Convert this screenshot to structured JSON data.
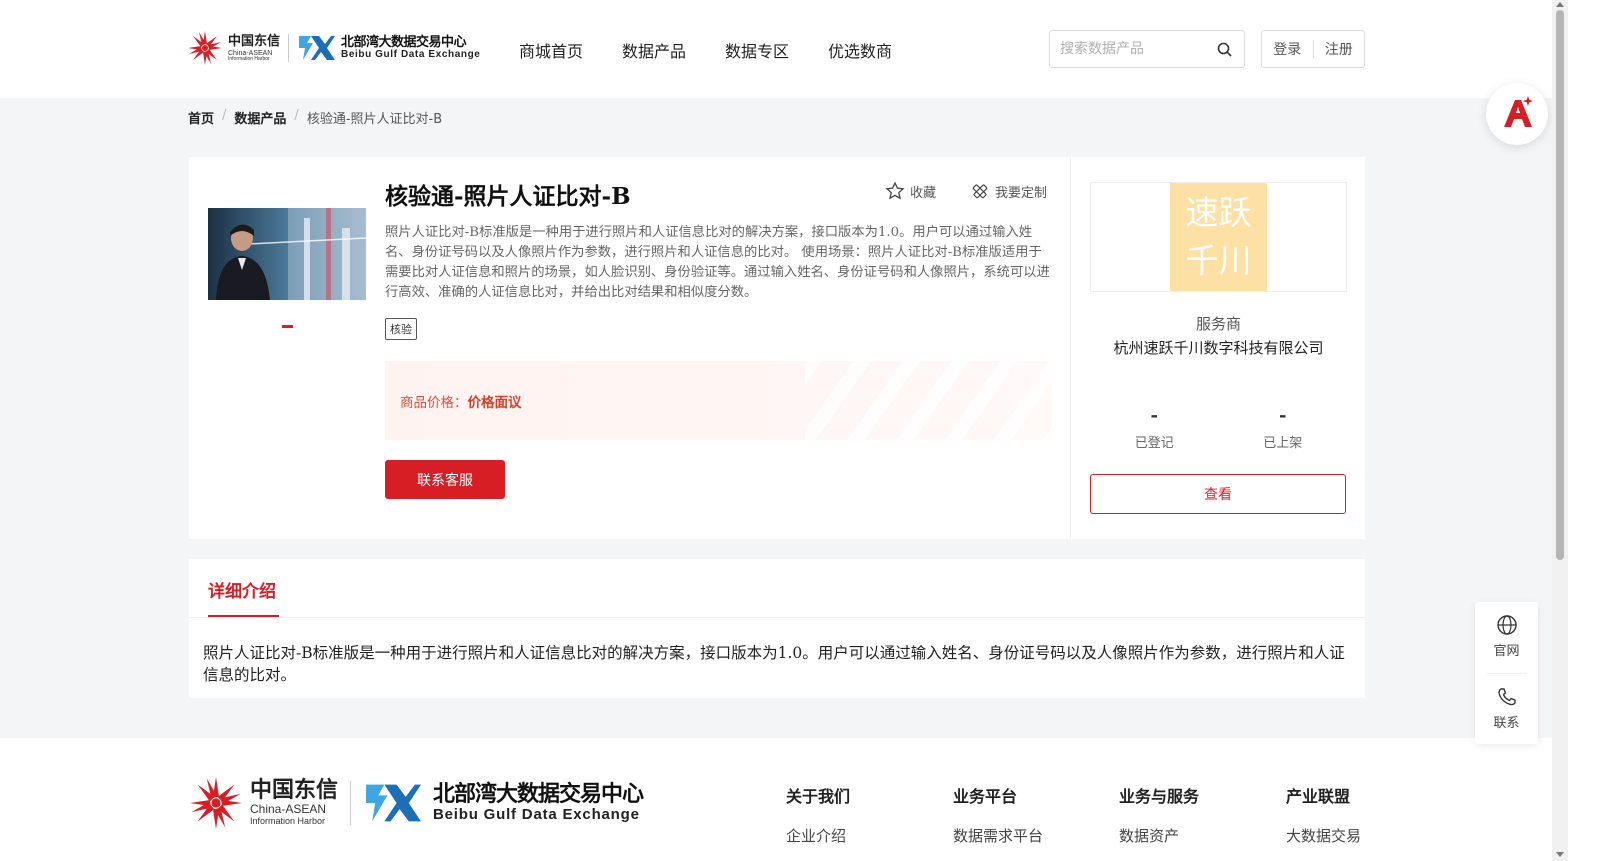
{
  "header": {
    "logo": {
      "partner_cn": "中国东信",
      "partner_en1": "China-ASEAN",
      "partner_en2": "Information Harbor",
      "brand_cn": "北部湾大数据交易中心",
      "brand_en": "Beibu Gulf Data Exchange"
    },
    "nav": [
      "商城首页",
      "数据产品",
      "数据专区",
      "优选数商"
    ],
    "search_placeholder": "搜索数据产品",
    "login": "登录",
    "register": "注册"
  },
  "breadcrumb": {
    "home": "首页",
    "category": "数据产品",
    "current": "核验通-照片人证比对-B",
    "separator": "/"
  },
  "product": {
    "title": "核验通-照片人证比对-B",
    "favorite": "收藏",
    "customize": "我要定制",
    "description": "照片人证比对-B标准版是一种用于进行照片和人证信息比对的解决方案，接口版本为1.0。用户可以通过输入姓名、身份证号码以及人像照片作为参数，进行照片和人证信息的比对。 使用场景：照片人证比对-B标准版适用于需要比对人证信息和照片的场景，如人脸识别、身份验证等。通过输入姓名、身份证号码和人像照片，系统可以进行高效、准确的人证信息比对，并给出比对结果和相似度分数。",
    "tag": "核验",
    "price_label": "商品价格：",
    "price_value": "价格面议",
    "contact_button": "联系客服"
  },
  "vendor": {
    "logo_line1": "速跃",
    "logo_line2": "千川",
    "role": "服务商",
    "name": "杭州速跃千川数字科技有限公司",
    "registered_value": "-",
    "registered_label": "已登记",
    "listed_value": "-",
    "listed_label": "已上架",
    "view_button": "查看"
  },
  "detail": {
    "tab": "详细介绍",
    "body": "照片人证比对-B标准版是一种用于进行照片和人证信息比对的解决方案，接口版本为1.0。用户可以通过输入姓名、身份证号码以及人像照片作为参数，进行照片和人证信息的比对。"
  },
  "footer": {
    "columns": [
      {
        "heading": "关于我们",
        "first_item": "企业介绍"
      },
      {
        "heading": "业务平台",
        "first_item": "数据需求平台"
      },
      {
        "heading": "业务与服务",
        "first_item": "数据资产"
      },
      {
        "heading": "产业联盟",
        "first_item": "大数据交易"
      }
    ]
  },
  "side_tools": {
    "website": "官网",
    "contact": "联系"
  },
  "colors": {
    "accent": "#d81e25",
    "price_text": "#e0503c",
    "vendor_logo_bg": "#fde0a4",
    "page_bg": "#f4f5f7"
  },
  "icons": [
    "search-icon",
    "star-icon",
    "customize-icon",
    "ai-assistant-icon",
    "globe-icon",
    "phone-icon"
  ]
}
